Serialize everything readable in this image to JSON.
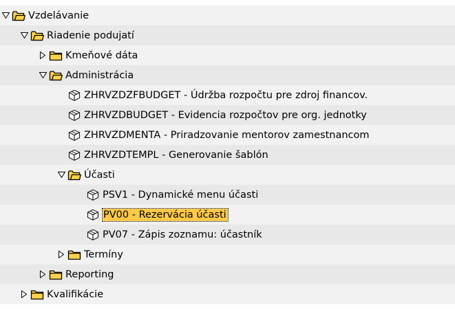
{
  "tree": {
    "items": [
      {
        "label": "Vzdelávanie",
        "type": "folder",
        "state": "expanded",
        "level": 0
      },
      {
        "label": "Riadenie podujatí",
        "type": "folder",
        "state": "expanded",
        "level": 1
      },
      {
        "label": "Kmeňové dáta",
        "type": "folder",
        "state": "collapsed",
        "level": 2
      },
      {
        "label": "Administrácia",
        "type": "folder",
        "state": "expanded",
        "level": 2
      },
      {
        "label": "ZHRVZDZFBUDGET - Údržba rozpočtu pre zdroj financov.",
        "type": "transaction",
        "level": 3
      },
      {
        "label": "ZHRVZDBUDGET - Evidencia rozpočtov pre org. jednotky",
        "type": "transaction",
        "level": 3
      },
      {
        "label": "ZHRVZDMENTA - Priradzovanie mentorov zamestnancom",
        "type": "transaction",
        "level": 3
      },
      {
        "label": "ZHRVZDTEMPL - Generovanie šablón",
        "type": "transaction",
        "level": 3
      },
      {
        "label": "Účasti",
        "type": "folder",
        "state": "expanded",
        "level": 3
      },
      {
        "label": "PSV1 - Dynamické menu účasti",
        "type": "transaction",
        "level": 4
      },
      {
        "label": "PV00 - Rezervácia účasti",
        "type": "transaction",
        "level": 4,
        "selected": true
      },
      {
        "label": "PV07 - Zápis zoznamu: účastník",
        "type": "transaction",
        "level": 4
      },
      {
        "label": "Termíny",
        "type": "folder",
        "state": "collapsed",
        "level": 3
      },
      {
        "label": "Reporting",
        "type": "folder",
        "state": "collapsed",
        "level": 2
      },
      {
        "label": "Kvalifikácie",
        "type": "folder",
        "state": "collapsed",
        "level": 1
      }
    ]
  },
  "icons": {
    "expanded": "triangle-down-icon",
    "collapsed": "triangle-right-icon",
    "folder_open": "folder-open-icon",
    "folder_closed": "folder-closed-icon",
    "transaction": "cube-icon"
  },
  "colors": {
    "row_light": "#f2f2f2",
    "row_dark": "#e8e8e8",
    "folder_fill": "#ffd24c",
    "folder_border": "#000000",
    "selection": "#ffc94a"
  }
}
